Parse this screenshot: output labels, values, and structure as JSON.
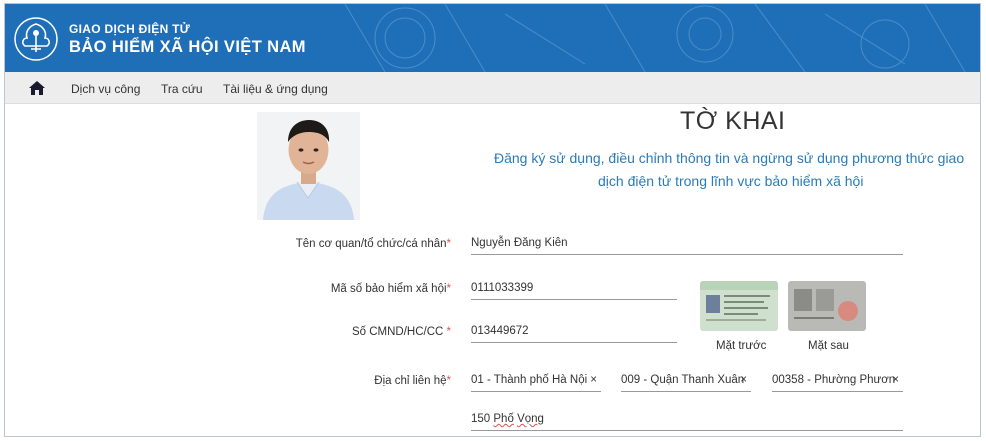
{
  "header": {
    "line1": "GIAO DỊCH ĐIỆN TỬ",
    "line2": "BẢO HIỂM XÃ HỘI VIỆT NAM",
    "logo_text": "BẢO HIỂM XÃ HỘI VIỆT NAM"
  },
  "nav": {
    "items": [
      {
        "label": "Dịch vụ công"
      },
      {
        "label": "Tra cứu"
      },
      {
        "label": "Tài liệu & ứng dụng"
      }
    ]
  },
  "form": {
    "title": "TỜ KHAI",
    "subtitle_line1": "Đăng ký sử dụng, điều chỉnh thông tin và ngừng sử dụng phương thức giao",
    "subtitle_line2": "dịch điện tử trong lĩnh vực bảo hiểm xã hội",
    "org_name_label": "Tên cơ quan/tổ chức/cá nhân",
    "org_name_value": "Nguyễn Đăng Kiên",
    "bhxh_label": "Mã số bảo hiểm xã hội",
    "bhxh_value": "0111033399",
    "id_label": "Số CMND/HC/CC ",
    "id_value": "013449672",
    "address_label": "Địa chỉ liên hệ",
    "province": "01 - Thành phố Hà Nội",
    "district": "009 - Quận Thanh Xuân",
    "ward": "00358 - Phường Phươn",
    "street_num": "150 ",
    "street_name_a": "Phố",
    "street_space": " ",
    "street_name_b": "Vọng",
    "required_mark": "*",
    "clear_mark": "×",
    "id_front_label": "Mặt trước",
    "id_back_label": "Mặt sau"
  },
  "colors": {
    "header_bg": "#1f6fb8",
    "accent_text": "#2a7bb8",
    "required": "#d9534f"
  },
  "icons": {
    "home": "home-icon",
    "logo": "vss-logo-icon",
    "clear": "clear-icon"
  }
}
